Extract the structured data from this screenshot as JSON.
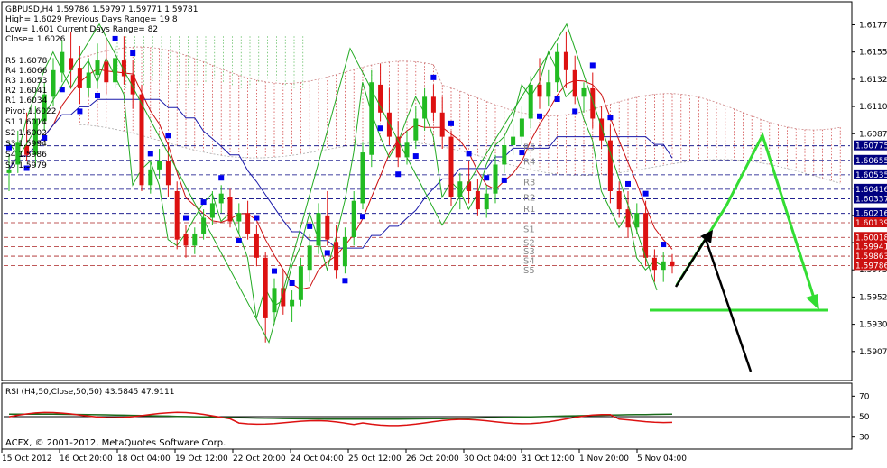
{
  "info": {
    "line1": "GBPUSD,H4  1.59786 1.59797 1.59771 1.59781",
    "line2": "High= 1.6029    Previous Days Range= 19.8",
    "line3": "Low= 1.601    Current Days Range= 82",
    "line4": "Close= 1.6026"
  },
  "pivot_list": [
    "R5 1.6078",
    "R4 1.6066",
    "R3 1.6053",
    "R2 1.6041",
    "R1 1.6034",
    "Pivot 1.6022",
    "S1 1.6014",
    "S2 1.6002",
    "S3 1.5994",
    "S4 1.5986",
    "S5 1.5979"
  ],
  "rsi_header": "RSI (H4,50,Close,50,50) 43.5845 47.9111",
  "copyright": "ACFX, © 2001-2012, MetaQuotes Software Corp.",
  "colors": {
    "bull": "#22bb22",
    "bear": "#dd1111",
    "price_badge_red": "#cc1111",
    "price_badge_navy": "#000080",
    "pattern_green": "#33dd33",
    "arrow_black": "#000000",
    "cloud": "#cc3333",
    "psar": "#0000ee"
  },
  "chart_data": {
    "type": "candlestick",
    "symbol": "GBPUSD",
    "timeframe": "H4",
    "ylim": [
      1.5885,
      1.6195
    ],
    "y_ticks": [
      "1.61775",
      "1.61550",
      "1.61325",
      "1.61100",
      "1.60875",
      "1.60650",
      "1.60425",
      "1.60200",
      "1.59975",
      "1.59750",
      "1.59525",
      "1.59300",
      "1.59075"
    ],
    "x_ticks": [
      "15 Oct 2012",
      "16 Oct 20:00",
      "18 Oct 04:00",
      "19 Oct 12:00",
      "22 Oct 20:00",
      "24 Oct 04:00",
      "25 Oct 12:00",
      "26 Oct 20:00",
      "30 Oct 04:00",
      "31 Oct 12:00",
      "1 Nov 20:00",
      "5 Nov 04:00"
    ],
    "price_badges": [
      {
        "text": "1.60775",
        "value": 1.60775,
        "style": "navy"
      },
      {
        "text": "1.60655",
        "value": 1.60655,
        "style": "navy"
      },
      {
        "text": "1.60535",
        "value": 1.60535,
        "style": "navy"
      },
      {
        "text": "1.60416",
        "value": 1.60416,
        "style": "navy"
      },
      {
        "text": "1.60337",
        "value": 1.60337,
        "style": "navy"
      },
      {
        "text": "1.60216",
        "value": 1.60216,
        "style": "navy"
      },
      {
        "text": "1.60139",
        "value": 1.60139,
        "style": "red"
      },
      {
        "text": "1.60018",
        "value": 1.60018,
        "style": "red"
      },
      {
        "text": "1.59941",
        "value": 1.59941,
        "style": "red"
      },
      {
        "text": "1.59863",
        "value": 1.59863,
        "style": "red"
      },
      {
        "text": "1.59786",
        "value": 1.59786,
        "style": "red"
      }
    ],
    "pivot_labels": [
      {
        "text": "R5",
        "value": 1.6077
      },
      {
        "text": "R4",
        "value": 1.6065
      },
      {
        "text": "R3",
        "value": 1.6048
      },
      {
        "text": "R2",
        "value": 1.6035
      },
      {
        "text": "R1",
        "value": 1.6026
      },
      {
        "text": "S1",
        "value": 1.6009
      },
      {
        "text": "S2",
        "value": 1.5998
      },
      {
        "text": "S3",
        "value": 1.5991
      },
      {
        "text": "S4",
        "value": 1.5983
      },
      {
        "text": "S5",
        "value": 1.5975
      }
    ],
    "candles": [
      [
        1.6055,
        1.607,
        1.6058,
        1.604
      ],
      [
        1.6062,
        1.609,
        1.608,
        1.6055
      ],
      [
        1.6078,
        1.6105,
        1.607,
        1.6065
      ],
      [
        1.607,
        1.611,
        1.61,
        1.606
      ],
      [
        1.6098,
        1.613,
        1.612,
        1.609
      ],
      [
        1.6118,
        1.615,
        1.614,
        1.611
      ],
      [
        1.6138,
        1.6165,
        1.6155,
        1.613
      ],
      [
        1.615,
        1.6172,
        1.614,
        1.6125
      ],
      [
        1.6142,
        1.616,
        1.6125,
        1.6112
      ],
      [
        1.6125,
        1.615,
        1.6138,
        1.6118
      ],
      [
        1.6136,
        1.6162,
        1.6148,
        1.6125
      ],
      [
        1.6147,
        1.6165,
        1.613,
        1.612
      ],
      [
        1.613,
        1.616,
        1.615,
        1.6125
      ],
      [
        1.6148,
        1.6168,
        1.6135,
        1.6128
      ],
      [
        1.6136,
        1.6148,
        1.612,
        1.6108
      ],
      [
        1.612,
        1.6128,
        1.6045,
        1.604
      ],
      [
        1.6045,
        1.6065,
        1.6058,
        1.6038
      ],
      [
        1.6058,
        1.6075,
        1.6065,
        1.605
      ],
      [
        1.6065,
        1.608,
        1.6045,
        1.6035
      ],
      [
        1.604,
        1.6048,
        1.6,
        1.5992
      ],
      [
        1.6005,
        1.6012,
        1.5995,
        1.5985
      ],
      [
        1.5995,
        1.601,
        1.6005,
        1.5988
      ],
      [
        1.6005,
        1.6025,
        1.6018,
        1.6
      ],
      [
        1.6018,
        1.604,
        1.603,
        1.6012
      ],
      [
        1.603,
        1.6045,
        1.6038,
        1.6022
      ],
      [
        1.6035,
        1.6042,
        1.6015,
        1.601
      ],
      [
        1.6015,
        1.603,
        1.6022,
        1.6005
      ],
      [
        1.6022,
        1.6032,
        1.6005,
        1.6
      ],
      [
        1.6005,
        1.6012,
        1.5985,
        1.5978
      ],
      [
        1.5985,
        1.599,
        1.5935,
        1.5915
      ],
      [
        1.594,
        1.5968,
        1.596,
        1.593
      ],
      [
        1.596,
        1.5975,
        1.5945,
        1.5938
      ],
      [
        1.5945,
        1.5958,
        1.595,
        1.5932
      ],
      [
        1.595,
        1.5985,
        1.5978,
        1.5945
      ],
      [
        1.5975,
        1.6005,
        1.5995,
        1.5965
      ],
      [
        1.5995,
        1.603,
        1.6022,
        1.5988
      ],
      [
        1.602,
        1.604,
        1.6,
        1.5995
      ],
      [
        1.5998,
        1.6012,
        1.5975,
        1.5968
      ],
      [
        1.5978,
        1.601,
        1.6002,
        1.5972
      ],
      [
        1.6002,
        1.604,
        1.6032,
        1.5995
      ],
      [
        1.603,
        1.608,
        1.6072,
        1.6025
      ],
      [
        1.607,
        1.614,
        1.613,
        1.606
      ],
      [
        1.6128,
        1.6145,
        1.6105,
        1.6098
      ],
      [
        1.6105,
        1.6125,
        1.6085,
        1.6078
      ],
      [
        1.6085,
        1.6098,
        1.6068,
        1.606
      ],
      [
        1.6068,
        1.609,
        1.608,
        1.6062
      ],
      [
        1.6082,
        1.611,
        1.61,
        1.6075
      ],
      [
        1.61,
        1.6125,
        1.6118,
        1.609
      ],
      [
        1.6118,
        1.6128,
        1.6105,
        1.6098
      ],
      [
        1.6105,
        1.6118,
        1.6085,
        1.6075
      ],
      [
        1.6085,
        1.609,
        1.6035,
        1.6028
      ],
      [
        1.6035,
        1.6055,
        1.6048,
        1.6025
      ],
      [
        1.6048,
        1.6065,
        1.604,
        1.603
      ],
      [
        1.604,
        1.605,
        1.6025,
        1.602
      ],
      [
        1.6025,
        1.6045,
        1.6038,
        1.6018
      ],
      [
        1.6038,
        1.607,
        1.6062,
        1.603
      ],
      [
        1.6062,
        1.6085,
        1.6078,
        1.6055
      ],
      [
        1.6078,
        1.6095,
        1.6085,
        1.607
      ],
      [
        1.6085,
        1.611,
        1.61,
        1.6078
      ],
      [
        1.61,
        1.6135,
        1.6128,
        1.6092
      ],
      [
        1.6128,
        1.615,
        1.6118,
        1.6108
      ],
      [
        1.6118,
        1.614,
        1.613,
        1.611
      ],
      [
        1.613,
        1.6162,
        1.6155,
        1.6122
      ],
      [
        1.6155,
        1.6172,
        1.614,
        1.6125
      ],
      [
        1.614,
        1.6152,
        1.6118,
        1.6112
      ],
      [
        1.6118,
        1.613,
        1.6125,
        1.6105
      ],
      [
        1.6125,
        1.6138,
        1.61,
        1.6092
      ],
      [
        1.61,
        1.611,
        1.6082,
        1.6075
      ],
      [
        1.6082,
        1.6095,
        1.604,
        1.603
      ],
      [
        1.604,
        1.6048,
        1.6025,
        1.6018
      ],
      [
        1.6025,
        1.604,
        1.601,
        1.6002
      ],
      [
        1.601,
        1.603,
        1.6022,
        1.6005
      ],
      [
        1.6022,
        1.6032,
        1.5985,
        1.5978
      ],
      [
        1.5985,
        1.5992,
        1.5975,
        1.5965
      ],
      [
        1.5975,
        1.599,
        1.5982,
        1.5965
      ],
      [
        1.5982,
        1.5988,
        1.5978,
        1.5972
      ]
    ],
    "annotations": [
      {
        "type": "zigzag",
        "color": "green"
      },
      {
        "type": "projection",
        "color": "green"
      },
      {
        "type": "arrow",
        "color": "black"
      }
    ],
    "rsi": {
      "levels": [
        70,
        50,
        30
      ],
      "y_ticks": [
        "70",
        "50",
        "30"
      ],
      "last_values": [
        43.5845,
        47.9111
      ]
    }
  }
}
